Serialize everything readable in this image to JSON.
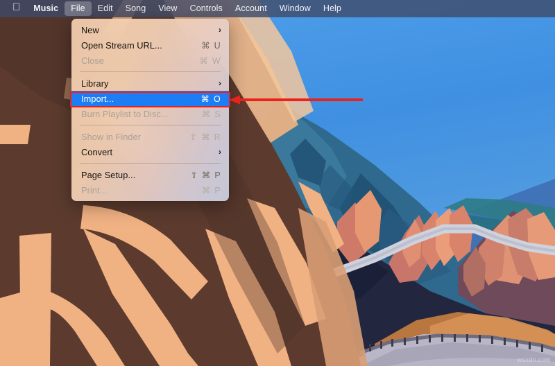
{
  "menubar": {
    "apple_icon": "apple-logo-icon",
    "items": [
      {
        "label": "Music",
        "bold": true,
        "active": false
      },
      {
        "label": "File",
        "bold": false,
        "active": true
      },
      {
        "label": "Edit",
        "bold": false,
        "active": false
      },
      {
        "label": "Song",
        "bold": false,
        "active": false
      },
      {
        "label": "View",
        "bold": false,
        "active": false
      },
      {
        "label": "Controls",
        "bold": false,
        "active": false
      },
      {
        "label": "Account",
        "bold": false,
        "active": false
      },
      {
        "label": "Window",
        "bold": false,
        "active": false
      },
      {
        "label": "Help",
        "bold": false,
        "active": false
      }
    ]
  },
  "file_menu": {
    "title": "File",
    "rows": [
      {
        "type": "item",
        "label": "New",
        "shortcut": "",
        "submenu": true,
        "disabled": false,
        "selected": false,
        "name": "menu-item-new"
      },
      {
        "type": "item",
        "label": "Open Stream URL...",
        "shortcut": "⌘ U",
        "submenu": false,
        "disabled": false,
        "selected": false,
        "name": "menu-item-open-stream-url"
      },
      {
        "type": "item",
        "label": "Close",
        "shortcut": "⌘ W",
        "submenu": false,
        "disabled": true,
        "selected": false,
        "name": "menu-item-close"
      },
      {
        "type": "separator",
        "name": "menu-separator-1"
      },
      {
        "type": "item",
        "label": "Library",
        "shortcut": "",
        "submenu": true,
        "disabled": false,
        "selected": false,
        "name": "menu-item-library"
      },
      {
        "type": "item",
        "label": "Import...",
        "shortcut": "⌘ O",
        "submenu": false,
        "disabled": false,
        "selected": true,
        "name": "menu-item-import"
      },
      {
        "type": "item",
        "label": "Burn Playlist to Disc...",
        "shortcut": "⌘ S",
        "submenu": false,
        "disabled": true,
        "selected": false,
        "name": "menu-item-burn-playlist-to-disc"
      },
      {
        "type": "separator",
        "name": "menu-separator-2"
      },
      {
        "type": "item",
        "label": "Show in Finder",
        "shortcut": "⇧ ⌘ R",
        "submenu": false,
        "disabled": true,
        "selected": false,
        "name": "menu-item-show-in-finder"
      },
      {
        "type": "item",
        "label": "Convert",
        "shortcut": "",
        "submenu": true,
        "disabled": false,
        "selected": false,
        "name": "menu-item-convert"
      },
      {
        "type": "separator",
        "name": "menu-separator-3"
      },
      {
        "type": "item",
        "label": "Page Setup...",
        "shortcut": "⇧ ⌘ P",
        "submenu": false,
        "disabled": false,
        "selected": false,
        "name": "menu-item-page-setup"
      },
      {
        "type": "item",
        "label": "Print...",
        "shortcut": "⌘ P",
        "submenu": false,
        "disabled": true,
        "selected": false,
        "name": "menu-item-print"
      }
    ]
  },
  "annotation": {
    "highlight_color": "#e8221c",
    "target": "Import..."
  },
  "watermark": {
    "text": "wsxdn.com"
  },
  "colors": {
    "menubar_bg": "#3e4a68",
    "menu_selection": "#1d7df5",
    "annotation_red": "#e8221c",
    "sky_blue": "#4a9ae4",
    "rock_brown": "#5c3b2e",
    "rock_tan": "#f0b183"
  }
}
